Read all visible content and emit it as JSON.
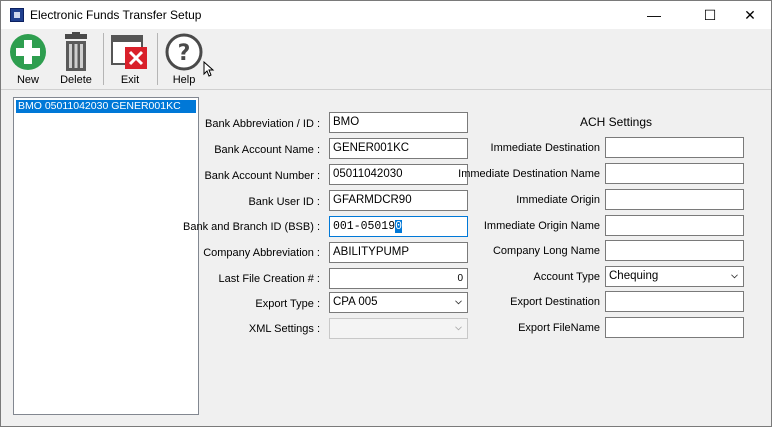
{
  "window": {
    "title": "Electronic Funds Transfer Setup",
    "controls": {
      "minimize": "—",
      "maximize": "☐",
      "close": "✕"
    }
  },
  "toolbar": {
    "new_label": "New",
    "delete_label": "Delete",
    "exit_label": "Exit",
    "help_label": "Help"
  },
  "list": {
    "items": [
      "BMO 05011042030 GENER001KC"
    ]
  },
  "form": {
    "bank_abbrev_label": "Bank Abbreviation / ID :",
    "bank_abbrev_value": "BMO",
    "account_name_label": "Bank Account Name :",
    "account_name_value": "GENER001KC",
    "account_number_label": "Bank Account Number :",
    "account_number_value": "05011042030",
    "user_id_label": "Bank User ID :",
    "user_id_value": "GFARMDCR90",
    "bsb_label": "Bank and Branch ID (BSB) :",
    "bsb_value": "001-05019",
    "bsb_selected": "0",
    "company_abbrev_label": "Company Abbreviation :",
    "company_abbrev_value": "ABILITYPUMP",
    "last_file_label": "Last File Creation # :",
    "last_file_value": "0",
    "export_type_label": "Export Type :",
    "export_type_value": "CPA 005",
    "xml_settings_label": "XML Settings :",
    "xml_settings_value": ""
  },
  "ach": {
    "title": "ACH Settings",
    "immediate_destination_label": "Immediate Destination",
    "immediate_destination_value": "",
    "immediate_destination_name_label": "Immediate Destination Name",
    "immediate_destination_name_value": "",
    "immediate_origin_label": "Immediate Origin",
    "immediate_origin_value": "",
    "immediate_origin_name_label": "Immediate Origin Name",
    "immediate_origin_name_value": "",
    "company_long_name_label": "Company Long Name",
    "company_long_name_value": "",
    "account_type_label": "Account Type",
    "account_type_value": "Chequing",
    "export_destination_label": "Export Destination",
    "export_destination_value": "",
    "export_filename_label": "Export FileName",
    "export_filename_value": ""
  },
  "colors": {
    "selection": "#0078d7",
    "new_icon": "#2e9e4f",
    "exit_icon": "#d9202a",
    "chrome": "#f0f0f0"
  },
  "icons": [
    "app-icon",
    "new-icon",
    "delete-icon",
    "exit-icon",
    "help-icon",
    "chevron-down-icon"
  ]
}
